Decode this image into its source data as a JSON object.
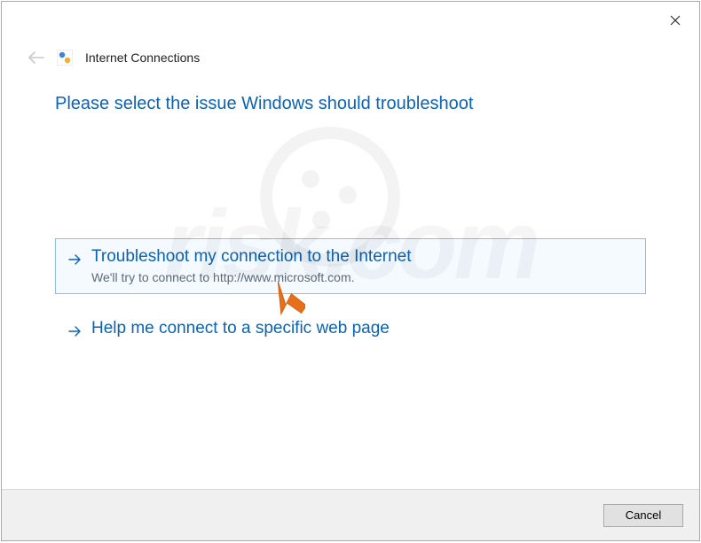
{
  "header": {
    "title": "Internet Connections"
  },
  "main": {
    "heading": "Please select the issue Windows should troubleshoot",
    "options": [
      {
        "title": "Troubleshoot my connection to the Internet",
        "desc": "We'll try to connect to http://www.microsoft.com."
      },
      {
        "title": "Help me connect to a specific web page"
      }
    ]
  },
  "footer": {
    "cancel": "Cancel"
  },
  "watermark": "risk.com"
}
